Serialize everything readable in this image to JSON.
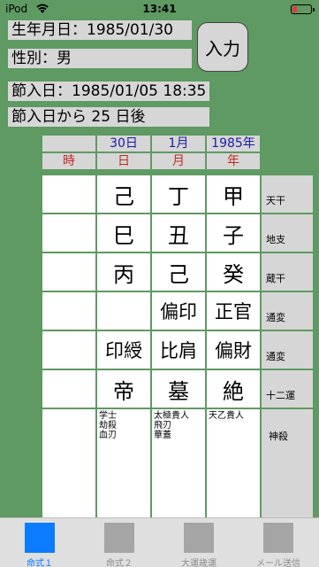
{
  "status": {
    "carrier": "iPod",
    "time": "13:41"
  },
  "info": {
    "birthdate": "生年月日：1985/01/30",
    "gender": "性別：男",
    "setsuiri_date": "節入日：1985/01/05 18:35",
    "days_after": "節入日から 25 日後",
    "input_button": "入力"
  },
  "header": {
    "values": [
      "",
      "30日",
      "1月",
      "1985年"
    ],
    "labels": [
      "時",
      "日",
      "月",
      "年"
    ]
  },
  "rows": {
    "tenkan": {
      "label": "天干",
      "cells": [
        "",
        "己",
        "丁",
        "甲"
      ]
    },
    "chishi": {
      "label": "地支",
      "cells": [
        "",
        "巳",
        "丑",
        "子"
      ]
    },
    "zoukan": {
      "label": "蔵干",
      "cells": [
        "",
        "丙",
        "己",
        "癸"
      ]
    },
    "tsuhen1": {
      "label": "通変",
      "cells": [
        "",
        "",
        "偏印",
        "正官"
      ]
    },
    "tsuhen2": {
      "label": "通変",
      "cells": [
        "",
        "印綬",
        "比肩",
        "偏財"
      ]
    },
    "juniun": {
      "label": "十二運",
      "cells": [
        "",
        "帝",
        "墓",
        "絶"
      ]
    },
    "shinsatsu": {
      "label": "神殺",
      "day": [
        "学士",
        "劫殺",
        "血刃"
      ],
      "month": [
        "太極貴人",
        "飛刃",
        "華蓋"
      ],
      "year": [
        "天乙貴人"
      ]
    }
  },
  "tabs": [
    {
      "label": "命式１",
      "active": true
    },
    {
      "label": "命式２",
      "active": false
    },
    {
      "label": "大運歳運",
      "active": false
    },
    {
      "label": "メール送信",
      "active": false
    }
  ]
}
